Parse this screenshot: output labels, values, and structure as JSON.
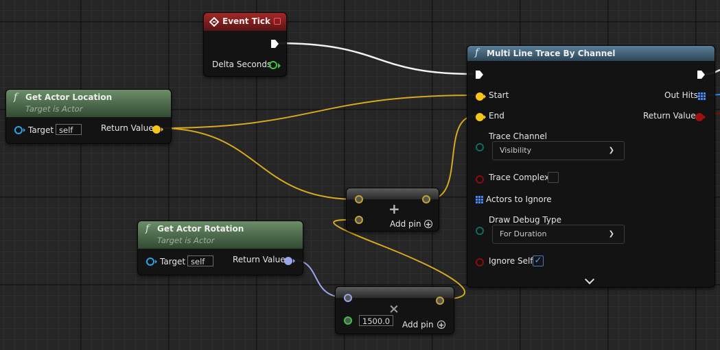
{
  "colors": {
    "vector_pin": "#f5c518",
    "rotator_pin": "#9aa7e8",
    "object_pin": "#2aa4e8",
    "float_pin": "#3ec43e",
    "bool_pin": "#8c0c0c",
    "enum_pin": "#0e6b61",
    "array_pin": "#2a8cff",
    "event_header": "#a52828",
    "function_header_green": "#4f6f4f",
    "function_header_blue": "#3e5e74"
  },
  "event_tick": {
    "title": "Event Tick",
    "delta_seconds": "Delta Seconds",
    "icon": "event-diamond-icon"
  },
  "get_actor_location": {
    "title": "Get Actor Location",
    "subtitle": "Target is Actor",
    "target_label": "Target",
    "target_value": "self",
    "return_label": "Return Value",
    "icon": "function-icon"
  },
  "get_actor_rotation": {
    "title": "Get Actor Rotation",
    "subtitle": "Target is Actor",
    "target_label": "Target",
    "target_value": "self",
    "return_label": "Return Value",
    "icon": "function-icon"
  },
  "add_node": {
    "symbol": "+",
    "add_pin_label": "Add pin"
  },
  "multiply_node": {
    "symbol": "×",
    "value": "1500.0",
    "add_pin_label": "Add pin"
  },
  "trace_node": {
    "title": "Multi Line Trace By Channel",
    "start": "Start",
    "end": "End",
    "out_hits": "Out Hits",
    "return_value": "Return Value",
    "trace_channel_label": "Trace Channel",
    "trace_channel_value": "Visibility",
    "trace_complex_label": "Trace Complex",
    "trace_complex_checked": false,
    "actors_to_ignore": "Actors to Ignore",
    "draw_debug_label": "Draw Debug Type",
    "draw_debug_value": "For Duration",
    "ignore_self_label": "Ignore Self",
    "ignore_self_checked": true,
    "expand_icon": "chevron-down-icon"
  }
}
